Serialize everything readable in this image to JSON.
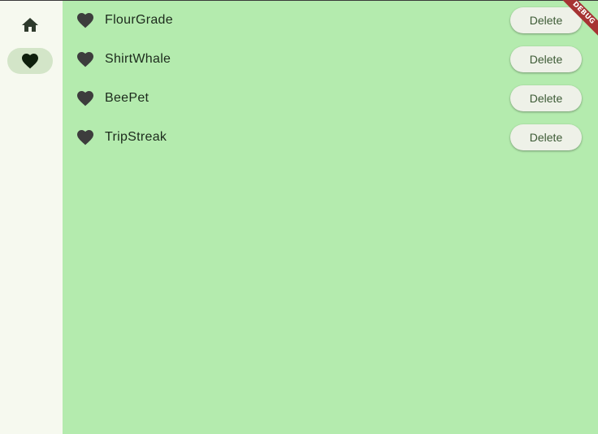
{
  "rail": {
    "destinations": [
      {
        "icon": "home-icon",
        "selected": false
      },
      {
        "icon": "heart-icon",
        "selected": true
      }
    ]
  },
  "favorites": {
    "items": [
      {
        "name": "FlourGrade",
        "action": "Delete"
      },
      {
        "name": "ShirtWhale",
        "action": "Delete"
      },
      {
        "name": "BeePet",
        "action": "Delete"
      },
      {
        "name": "TripStreak",
        "action": "Delete"
      }
    ]
  },
  "debug_banner": "DEBUG",
  "colors": {
    "rail_background": "#f6f9ef",
    "content_background": "#b4ebae",
    "selected_indicator": "#d3e5c8",
    "button_background": "#eef1e8",
    "button_text": "#3c5a35",
    "debug_ribbon": "#a63333"
  }
}
